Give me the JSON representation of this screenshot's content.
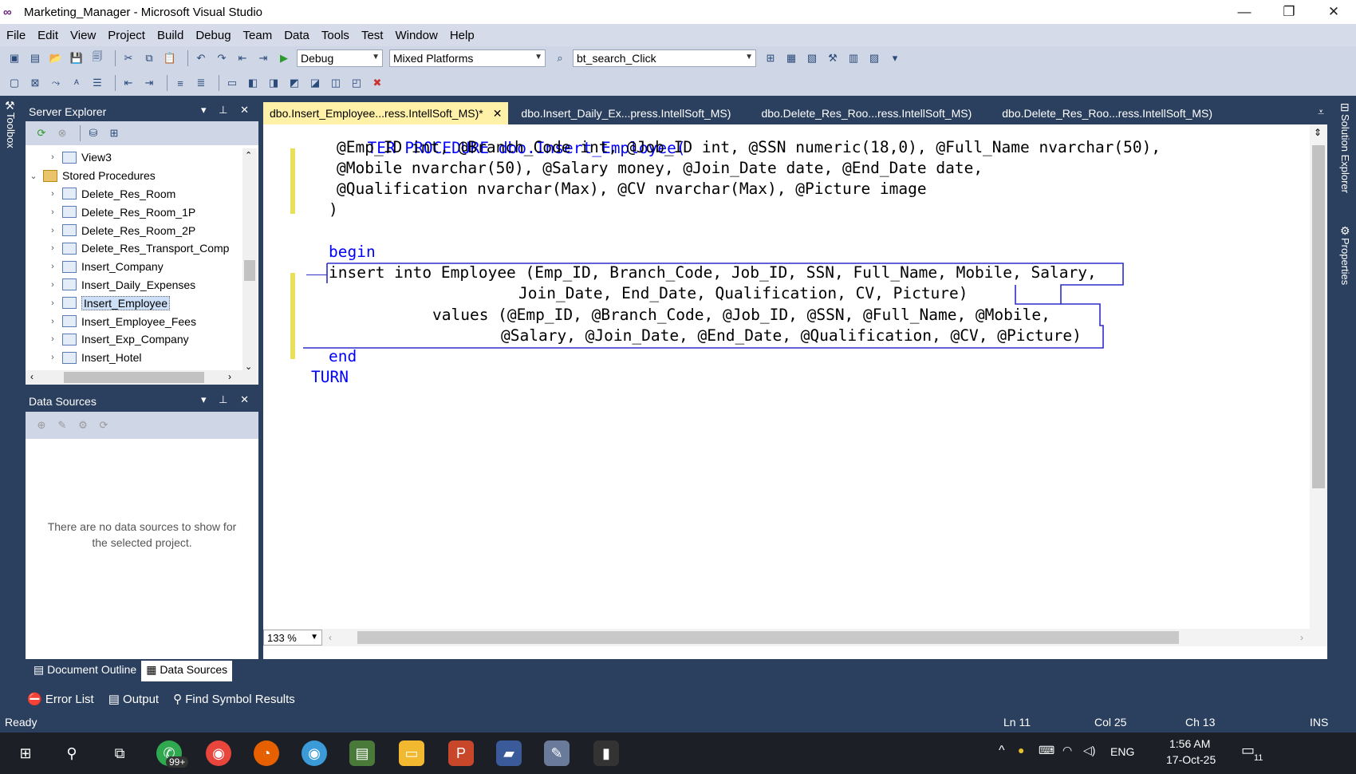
{
  "window": {
    "title": "Marketing_Manager - Microsoft Visual Studio",
    "logo": "∞",
    "controls": [
      "—",
      "❐",
      "✕"
    ]
  },
  "menu": [
    "File",
    "Edit",
    "View",
    "Project",
    "Build",
    "Debug",
    "Team",
    "Data",
    "Tools",
    "Test",
    "Window",
    "Help"
  ],
  "toolbar": {
    "configuration": "Debug",
    "platform": "Mixed Platforms",
    "navigate_to": "bt_search_Click"
  },
  "side_strips": {
    "left": "Toolbox",
    "right_top": "Solution Explorer",
    "right_bottom": "Properties"
  },
  "server_explorer": {
    "title": "Server Explorer",
    "tree": [
      {
        "label": "View3",
        "expander": "›",
        "type": "view"
      },
      {
        "label": "Stored Procedures",
        "expander": "⌄",
        "type": "folder"
      },
      {
        "label": "Delete_Res_Room",
        "expander": "›",
        "type": "proc"
      },
      {
        "label": "Delete_Res_Room_1P",
        "expander": "›",
        "type": "proc"
      },
      {
        "label": "Delete_Res_Room_2P",
        "expander": "›",
        "type": "proc"
      },
      {
        "label": "Delete_Res_Transport_Comp",
        "expander": "›",
        "type": "proc"
      },
      {
        "label": "Insert_Company",
        "expander": "›",
        "type": "proc"
      },
      {
        "label": "Insert_Daily_Expenses",
        "expander": "›",
        "type": "proc"
      },
      {
        "label": "Insert_Employee",
        "expander": "›",
        "type": "proc",
        "selected": true
      },
      {
        "label": "Insert_Employee_Fees",
        "expander": "›",
        "type": "proc"
      },
      {
        "label": "Insert_Exp_Company",
        "expander": "›",
        "type": "proc"
      },
      {
        "label": "Insert_Hotel",
        "expander": "›",
        "type": "proc"
      }
    ]
  },
  "data_sources": {
    "title": "Data Sources",
    "empty_line1": "There are no data sources to show for",
    "empty_line2": "the selected project."
  },
  "bottom_panel_tabs": [
    "Document Outline",
    "Data Sources"
  ],
  "doc_tabs": [
    "dbo.Insert_Employee...ress.IntellSoft_MS)*",
    "dbo.Insert_Daily_Ex...press.IntellSoft_MS)",
    "dbo.Delete_Res_Roo...ress.IntellSoft_MS)",
    "dbo.Delete_Res_Roo...ress.IntellSoft_MS)"
  ],
  "code": {
    "l1": "TER PROCEDURE dbo.Insert_Employee(",
    "l2": "@Emp_ID int, @Branch_Code int, @Job_ID int, @SSN numeric(18,0), @Full_Name nvarchar(50),",
    "l3": "@Mobile nvarchar(50), @Salary money, @Join_Date date, @End_Date date,",
    "l4": "@Qualification nvarchar(Max), @CV nvarchar(Max), @Picture image",
    "l5": ")",
    "l6": "begin",
    "l7": "insert into Employee (Emp_ID, Branch_Code, Job_ID, SSN, Full_Name, Mobile, Salary,",
    "l8": "Join_Date, End_Date, Qualification, CV, Picture)",
    "l9": "values (@Emp_ID, @Branch_Code, @Job_ID, @SSN, @Full_Name, @Mobile,",
    "l10": "@Salary, @Join_Date, @End_Date, @Qualification, @CV, @Picture)",
    "l11": "end",
    "l12": "TURN"
  },
  "zoom": "133 %",
  "output_tabs": [
    "Error List",
    "Output",
    "Find Symbol Results"
  ],
  "status": {
    "state": "Ready",
    "line": "Ln 11",
    "col": "Col 25",
    "ch": "Ch 13",
    "mode": "INS"
  },
  "taskbar": {
    "badge": "99+",
    "lang": "ENG",
    "time": "1:56 AM",
    "date": "17-Oct-25",
    "notif": "11"
  },
  "colors": {
    "keyword": "#0000ff",
    "chrome": "#2b3f5e",
    "active_tab": "#fff1a8",
    "change_marker": "#e8e05a"
  }
}
